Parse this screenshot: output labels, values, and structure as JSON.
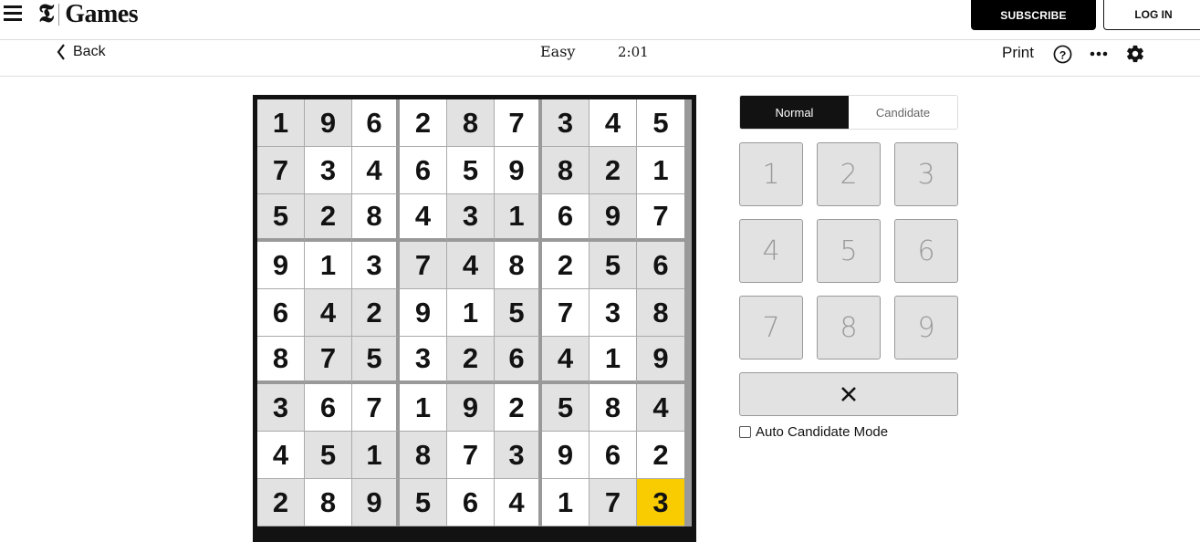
{
  "header": {
    "logo_mark": "𝕿",
    "logo_text": "Games",
    "subscribe_label": "SUBSCRIBE",
    "login_label": "LOG IN"
  },
  "toolbar": {
    "back_label": "Back",
    "difficulty": "Easy",
    "timer": "2:01",
    "print_label": "Print",
    "icons": [
      "help-icon",
      "more-icon",
      "gear-icon"
    ]
  },
  "board": {
    "rows": [
      [
        {
          "v": "1",
          "g": true
        },
        {
          "v": "9",
          "g": true
        },
        {
          "v": "6",
          "g": false
        },
        {
          "v": "2",
          "g": false
        },
        {
          "v": "8",
          "g": true
        },
        {
          "v": "7",
          "g": false
        },
        {
          "v": "3",
          "g": true
        },
        {
          "v": "4",
          "g": false
        },
        {
          "v": "5",
          "g": false
        }
      ],
      [
        {
          "v": "7",
          "g": true
        },
        {
          "v": "3",
          "g": false
        },
        {
          "v": "4",
          "g": false
        },
        {
          "v": "6",
          "g": false
        },
        {
          "v": "5",
          "g": false
        },
        {
          "v": "9",
          "g": false
        },
        {
          "v": "8",
          "g": true
        },
        {
          "v": "2",
          "g": true
        },
        {
          "v": "1",
          "g": false
        }
      ],
      [
        {
          "v": "5",
          "g": true
        },
        {
          "v": "2",
          "g": true
        },
        {
          "v": "8",
          "g": false
        },
        {
          "v": "4",
          "g": false
        },
        {
          "v": "3",
          "g": true
        },
        {
          "v": "1",
          "g": true
        },
        {
          "v": "6",
          "g": false
        },
        {
          "v": "9",
          "g": true
        },
        {
          "v": "7",
          "g": false
        }
      ],
      [
        {
          "v": "9",
          "g": false
        },
        {
          "v": "1",
          "g": false
        },
        {
          "v": "3",
          "g": false
        },
        {
          "v": "7",
          "g": true
        },
        {
          "v": "4",
          "g": true
        },
        {
          "v": "8",
          "g": false
        },
        {
          "v": "2",
          "g": false
        },
        {
          "v": "5",
          "g": true
        },
        {
          "v": "6",
          "g": true
        }
      ],
      [
        {
          "v": "6",
          "g": false
        },
        {
          "v": "4",
          "g": true
        },
        {
          "v": "2",
          "g": true
        },
        {
          "v": "9",
          "g": false
        },
        {
          "v": "1",
          "g": false
        },
        {
          "v": "5",
          "g": true
        },
        {
          "v": "7",
          "g": false
        },
        {
          "v": "3",
          "g": false
        },
        {
          "v": "8",
          "g": true
        }
      ],
      [
        {
          "v": "8",
          "g": false
        },
        {
          "v": "7",
          "g": true
        },
        {
          "v": "5",
          "g": true
        },
        {
          "v": "3",
          "g": false
        },
        {
          "v": "2",
          "g": true
        },
        {
          "v": "6",
          "g": true
        },
        {
          "v": "4",
          "g": true
        },
        {
          "v": "1",
          "g": false
        },
        {
          "v": "9",
          "g": true
        }
      ],
      [
        {
          "v": "3",
          "g": true
        },
        {
          "v": "6",
          "g": false
        },
        {
          "v": "7",
          "g": false
        },
        {
          "v": "1",
          "g": false
        },
        {
          "v": "9",
          "g": true
        },
        {
          "v": "2",
          "g": false
        },
        {
          "v": "5",
          "g": true
        },
        {
          "v": "8",
          "g": false
        },
        {
          "v": "4",
          "g": true
        }
      ],
      [
        {
          "v": "4",
          "g": false
        },
        {
          "v": "5",
          "g": true
        },
        {
          "v": "1",
          "g": true
        },
        {
          "v": "8",
          "g": true
        },
        {
          "v": "7",
          "g": false
        },
        {
          "v": "3",
          "g": true
        },
        {
          "v": "9",
          "g": false
        },
        {
          "v": "6",
          "g": false
        },
        {
          "v": "2",
          "g": false
        }
      ],
      [
        {
          "v": "2",
          "g": true
        },
        {
          "v": "8",
          "g": false
        },
        {
          "v": "9",
          "g": true
        },
        {
          "v": "5",
          "g": true
        },
        {
          "v": "6",
          "g": false
        },
        {
          "v": "4",
          "g": false
        },
        {
          "v": "1",
          "g": false
        },
        {
          "v": "7",
          "g": true
        },
        {
          "v": "3",
          "g": false,
          "selected": true
        }
      ]
    ],
    "selected_color": "#f8cc00",
    "given_color": "#e2e2e2"
  },
  "controls": {
    "mode_normal": "Normal",
    "mode_candidate": "Candidate",
    "active_mode": "Normal",
    "numbers": [
      "1",
      "2",
      "3",
      "4",
      "5",
      "6",
      "7",
      "8",
      "9"
    ],
    "erase_icon": "close-icon",
    "auto_candidate_label": "Auto Candidate Mode",
    "auto_candidate_checked": false
  }
}
